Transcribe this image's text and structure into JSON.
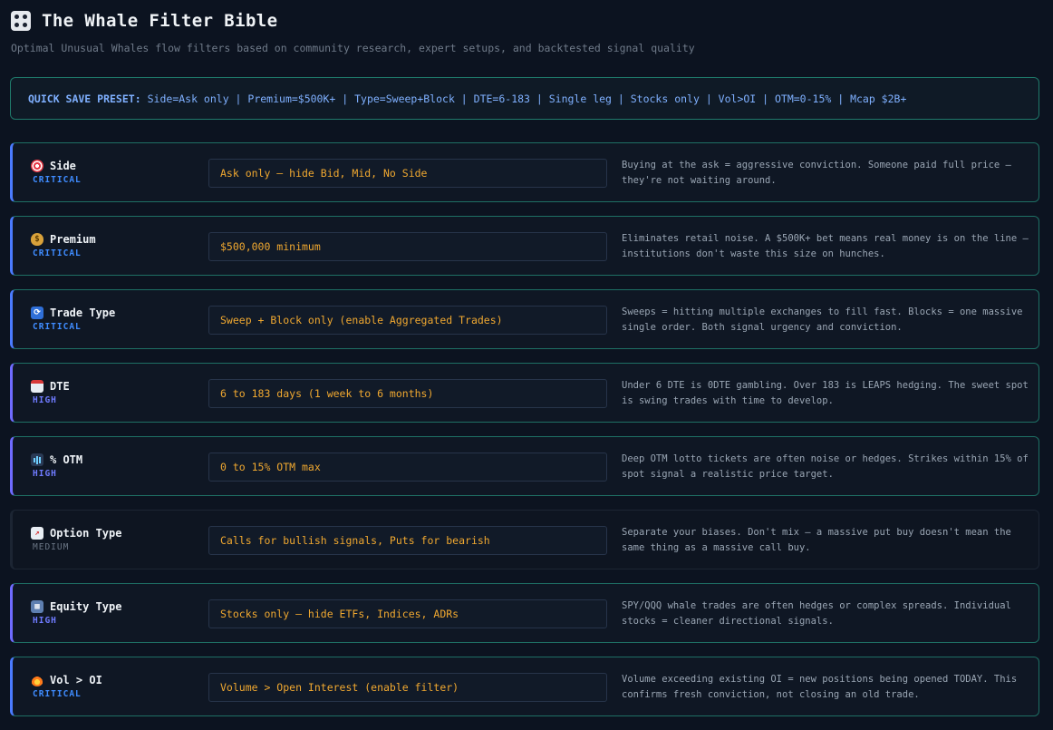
{
  "header": {
    "title": "The Whale Filter Bible",
    "subtitle": "Optimal Unusual Whales flow filters based on community research, expert setups, and backtested signal quality"
  },
  "preset": {
    "label": "QUICK SAVE PRESET:",
    "text": "Side=Ask only | Premium=$500K+ | Type=Sweep+Block | DTE=6-183 | Single leg | Stocks only | Vol>OI | OTM=0-15% | Mcap $2B+"
  },
  "filters": [
    {
      "icon": "target-icon",
      "name": "Side",
      "priority": "CRITICAL",
      "value": "Ask only — hide Bid, Mid, No Side",
      "desc": "Buying at the ask = aggressive conviction. Someone paid full price — they're not waiting around."
    },
    {
      "icon": "money-bag-icon",
      "name": "Premium",
      "priority": "CRITICAL",
      "value": "$500,000 minimum",
      "desc": "Eliminates retail noise. A $500K+ bet means real money is on the line — institutions don't waste this size on hunches."
    },
    {
      "icon": "cycle-arrows-icon",
      "name": "Trade Type",
      "priority": "CRITICAL",
      "value": "Sweep + Block only (enable Aggregated Trades)",
      "desc": "Sweeps = hitting multiple exchanges to fill fast. Blocks = one massive single order. Both signal urgency and conviction."
    },
    {
      "icon": "calendar-icon",
      "name": "DTE",
      "priority": "HIGH",
      "value": "6 to 183 days (1 week to 6 months)",
      "desc": "Under 6 DTE is 0DTE gambling. Over 183 is LEAPS hedging. The sweet spot is swing trades with time to develop."
    },
    {
      "icon": "bar-chart-icon",
      "name": "% OTM",
      "priority": "HIGH",
      "value": "0 to 15% OTM max",
      "desc": "Deep OTM lotto tickets are often noise or hedges. Strikes within 15% of spot signal a realistic price target."
    },
    {
      "icon": "trend-chart-icon",
      "name": "Option Type",
      "priority": "MEDIUM",
      "value": "Calls for bullish signals, Puts for bearish",
      "desc": "Separate your biases. Don't mix — a massive put buy doesn't mean the same thing as a massive call buy."
    },
    {
      "icon": "building-icon",
      "name": "Equity Type",
      "priority": "HIGH",
      "value": "Stocks only — hide ETFs, Indices, ADRs",
      "desc": "SPY/QQQ whale trades are often hedges or complex spreads. Individual stocks = cleaner directional signals."
    },
    {
      "icon": "fire-icon",
      "name": "Vol > OI",
      "priority": "CRITICAL",
      "value": "Volume > Open Interest (enable filter)",
      "desc": "Volume exceeding existing OI = new positions being opened TODAY. This confirms fresh conviction, not closing an old trade."
    }
  ]
}
